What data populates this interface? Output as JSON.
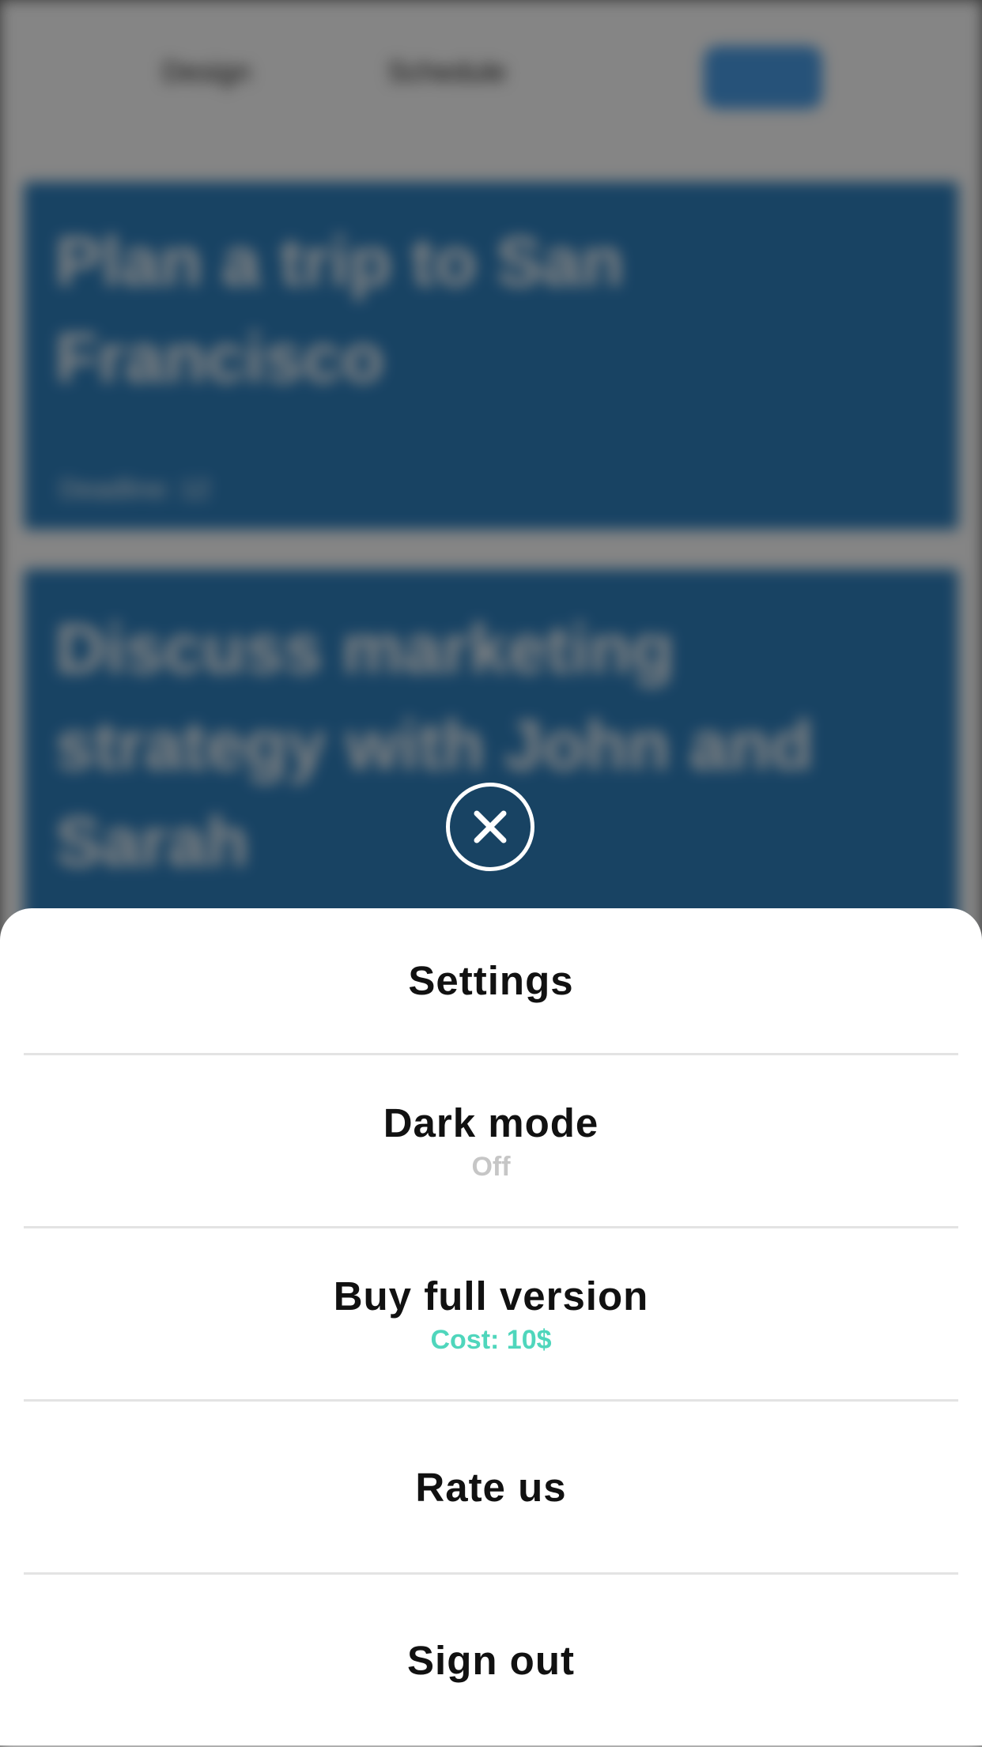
{
  "background": {
    "header": {
      "link_1": "Design",
      "link_2": "Schedule",
      "button_color": "#4a9ee8"
    },
    "cards": [
      {
        "title": "Plan a trip to San Francisco",
        "subtitle": "Deadline: 12"
      },
      {
        "title": "Discuss marketing strategy with John and Sarah",
        "subtitle": ""
      }
    ],
    "card_color": "#2e80bf"
  },
  "overlay": {
    "close_icon": "close-icon"
  },
  "sheet": {
    "title": "Settings",
    "items": [
      {
        "label": "Dark mode",
        "sub": "Off",
        "sub_color": "#c6c6c6"
      },
      {
        "label": "Buy full version",
        "sub": "Cost: 10$",
        "sub_color": "#4fd6bc"
      },
      {
        "label": "Rate us",
        "sub": "",
        "sub_color": ""
      },
      {
        "label": "Sign out",
        "sub": "",
        "sub_color": ""
      }
    ]
  }
}
